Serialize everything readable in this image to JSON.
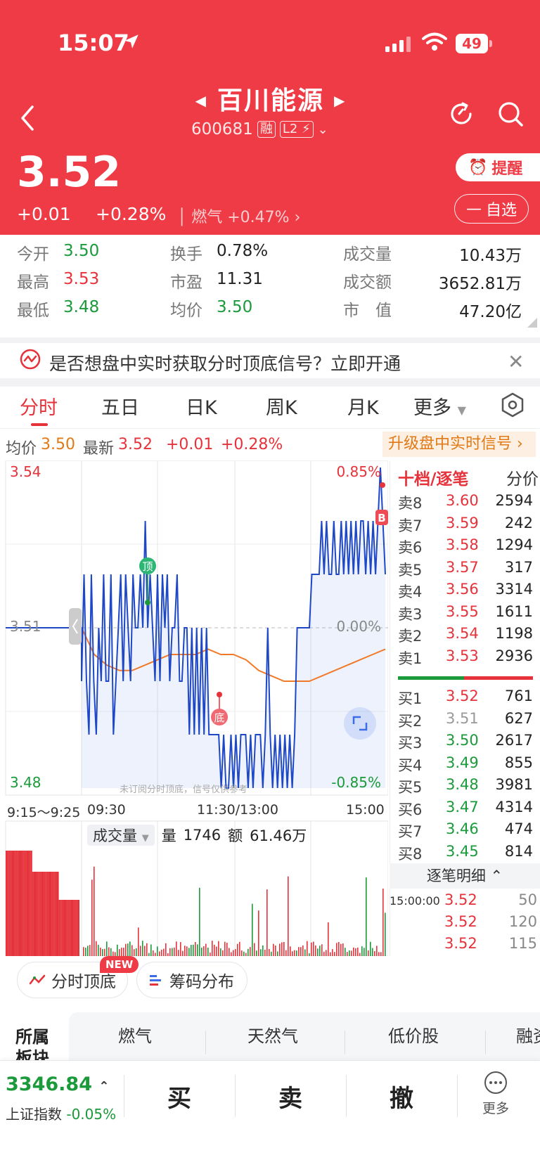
{
  "status": {
    "time": "15:07",
    "battery": "49"
  },
  "stock": {
    "name": "百川能源",
    "code": "600681",
    "tag_margin": "融",
    "tag_l2": "L2",
    "price": "3.52",
    "change": "+0.01",
    "change_pct": "+0.28%",
    "sector_line": "燃气  +0.47%",
    "remind_label": "提醒",
    "watchlist_label": "自选"
  },
  "stats": [
    {
      "label": "今开",
      "value": "3.50",
      "color": "green"
    },
    {
      "label": "最高",
      "value": "3.53",
      "color": "red"
    },
    {
      "label": "最低",
      "value": "3.48",
      "color": "green"
    },
    {
      "label": "换手",
      "value": "0.78%",
      "color": "black"
    },
    {
      "label": "市盈",
      "value": "11.31",
      "color": "black"
    },
    {
      "label": "均价",
      "value": "3.50",
      "color": "green"
    },
    {
      "label": "成交量",
      "value": "10.43万",
      "color": "black"
    },
    {
      "label": "成交额",
      "value": "3652.81万",
      "color": "black"
    },
    {
      "label": "市　值",
      "value": "47.20亿",
      "color": "black"
    }
  ],
  "banner": {
    "text": "是否想盘中实时获取分时顶底信号？立即开通",
    "close": "✕"
  },
  "tabs": [
    "分时",
    "五日",
    "日K",
    "周K",
    "月K",
    "更多"
  ],
  "avg_row": {
    "avg_label": "均价",
    "avg_value": "3.50",
    "latest_label": "最新",
    "latest_value": "3.52",
    "change": "+0.01",
    "change_pct": "+0.28%",
    "upgrade": "升级盘中实时信号"
  },
  "chart_axes": {
    "y_top": "3.54",
    "y_mid": "3.51",
    "y_bottom": "3.48",
    "pct_top": "0.85%",
    "pct_mid": "0.00%",
    "pct_bottom": "-0.85%",
    "watermark": "未订阅分时顶底，信号仅供参考",
    "top_marker": "顶",
    "bottom_marker": "底",
    "buy_marker": "B",
    "time_labels": [
      "9:15～9:25",
      "09:30",
      "11:30/13:00",
      "15:00"
    ]
  },
  "chart_data": {
    "type": "line",
    "title": "",
    "ylim": [
      3.48,
      3.54
    ],
    "series": [
      {
        "name": "",
        "description": "price",
        "values": [
          3.51,
          3.51,
          3.51,
          3.51,
          3.51,
          3.51,
          3.51,
          3.51,
          3.51,
          3.51,
          3.51,
          3.51,
          3.51,
          3.51,
          3.51,
          3.51,
          3.51,
          3.51,
          3.51,
          3.51,
          3.51,
          3.51,
          3.51,
          3.5,
          3.52,
          3.5,
          3.49,
          3.52,
          3.5,
          3.49,
          3.51,
          3.5,
          3.52,
          3.5,
          3.5,
          3.52,
          3.49,
          3.5,
          3.51,
          3.52,
          3.5,
          3.52,
          3.51,
          3.5,
          3.52,
          3.51,
          3.51,
          3.52,
          3.51,
          3.53,
          3.51,
          3.52,
          3.51,
          3.5,
          3.52,
          3.5,
          3.52,
          3.51,
          3.52,
          3.5,
          3.51,
          3.51,
          3.52,
          3.5,
          3.5,
          3.51,
          3.51,
          3.49,
          3.51,
          3.49,
          3.51,
          3.49,
          3.51,
          3.49,
          3.51,
          3.49,
          3.49,
          3.49,
          3.49,
          3.49,
          3.48,
          3.49,
          3.48,
          3.48,
          3.49,
          3.48,
          3.49,
          3.48,
          3.49,
          3.49,
          3.49,
          3.48,
          3.49,
          3.48,
          3.49,
          3.49,
          3.49,
          3.48,
          3.49,
          3.51,
          3.49,
          3.48,
          3.49,
          3.48,
          3.49,
          3.48,
          3.49,
          3.48,
          3.49,
          3.48,
          3.49,
          3.51,
          3.51,
          3.51,
          3.51,
          3.51,
          3.51,
          3.52,
          3.52,
          3.52,
          3.52,
          3.53,
          3.52,
          3.53,
          3.52,
          3.52,
          3.53,
          3.52,
          3.52,
          3.53,
          3.52,
          3.53,
          3.52,
          3.53,
          3.52,
          3.53,
          3.52,
          3.53,
          3.53,
          3.52,
          3.53,
          3.52,
          3.53,
          3.52,
          3.53,
          3.54,
          3.53,
          3.52
        ]
      },
      {
        "name": "",
        "description": "average",
        "values": [
          3.51,
          3.505,
          3.503,
          3.502,
          3.502,
          3.503,
          3.504,
          3.505,
          3.505,
          3.505,
          3.506,
          3.505,
          3.505,
          3.504,
          3.502,
          3.501,
          3.5,
          3.5,
          3.5,
          3.501,
          3.502,
          3.503,
          3.504,
          3.505,
          3.506
        ]
      }
    ]
  },
  "volume": {
    "tab": "成交量",
    "qty_label": "量",
    "qty": "1746",
    "amt_label": "额",
    "amt": "61.46万"
  },
  "book": {
    "title": "十档/逐笔",
    "price_col": "分价",
    "asks": [
      {
        "label": "卖8",
        "price": "3.60",
        "qty": "2594",
        "color": "red"
      },
      {
        "label": "卖7",
        "price": "3.59",
        "qty": "242",
        "color": "red"
      },
      {
        "label": "卖6",
        "price": "3.58",
        "qty": "1294",
        "color": "red"
      },
      {
        "label": "卖5",
        "price": "3.57",
        "qty": "317",
        "color": "red"
      },
      {
        "label": "卖4",
        "price": "3.56",
        "qty": "3314",
        "color": "red"
      },
      {
        "label": "卖3",
        "price": "3.55",
        "qty": "1611",
        "color": "red"
      },
      {
        "label": "卖2",
        "price": "3.54",
        "qty": "1198",
        "color": "red"
      },
      {
        "label": "卖1",
        "price": "3.53",
        "qty": "2936",
        "color": "red"
      }
    ],
    "bids": [
      {
        "label": "买1",
        "price": "3.52",
        "qty": "761",
        "color": "red"
      },
      {
        "label": "买2",
        "price": "3.51",
        "qty": "627",
        "color": "gray"
      },
      {
        "label": "买3",
        "price": "3.50",
        "qty": "2617",
        "color": "green"
      },
      {
        "label": "买4",
        "price": "3.49",
        "qty": "855",
        "color": "green"
      },
      {
        "label": "买5",
        "price": "3.48",
        "qty": "3981",
        "color": "green"
      },
      {
        "label": "买6",
        "price": "3.47",
        "qty": "4314",
        "color": "green"
      },
      {
        "label": "买7",
        "price": "3.46",
        "qty": "474",
        "color": "green"
      },
      {
        "label": "买8",
        "price": "3.45",
        "qty": "814",
        "color": "green"
      }
    ],
    "trade_title": "逐笔明细",
    "trades": [
      {
        "time": "15:00:00",
        "price": "3.52",
        "qty": "50"
      },
      {
        "time": "",
        "price": "3.52",
        "qty": "120"
      },
      {
        "time": "",
        "price": "3.52",
        "qty": "115"
      }
    ]
  },
  "chips": {
    "signals": "分时顶底",
    "new": "NEW",
    "chips_dist": "筹码分布"
  },
  "sectors": {
    "label": "所属板块",
    "items": [
      {
        "name": "燃气"
      },
      {
        "name": "天然气"
      },
      {
        "name": "低价股"
      },
      {
        "name": "融资"
      }
    ]
  },
  "bottom": {
    "index_value": "3346.84",
    "index_name": "上证指数",
    "index_change": "-0.05%",
    "buy": "买",
    "sell": "卖",
    "cancel": "撤",
    "more": "更多"
  },
  "colors": {
    "header": "#ef3b45",
    "up": "#e6323a",
    "down": "#1a9a3a",
    "price_line": "#1f48c6",
    "avg_line": "#f07a2a"
  }
}
